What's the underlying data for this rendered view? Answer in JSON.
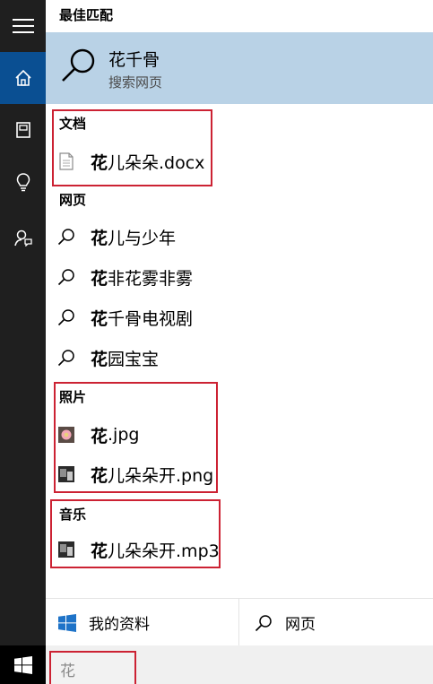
{
  "sidebar": {
    "items": [
      {
        "name": "menu",
        "active": false
      },
      {
        "name": "home",
        "active": true
      },
      {
        "name": "notebook",
        "active": false
      },
      {
        "name": "reminders",
        "active": false
      },
      {
        "name": "feedback",
        "active": false
      }
    ]
  },
  "results": {
    "best_match_label": "最佳匹配",
    "best_match": {
      "title": "花千骨",
      "subtitle": "搜索网页"
    },
    "documents_label": "文档",
    "documents": [
      {
        "bold": "花",
        "rest": "儿朵朵.docx",
        "icon": "document-icon"
      }
    ],
    "web_label": "网页",
    "web": [
      {
        "bold": "花",
        "rest": "儿与少年"
      },
      {
        "bold": "花",
        "rest": "非花雾非雾"
      },
      {
        "bold": "花",
        "rest": "千骨电视剧"
      },
      {
        "bold": "花",
        "rest": "园宝宝"
      }
    ],
    "photos_label": "照片",
    "photos": [
      {
        "bold": "花",
        "rest": ".jpg"
      },
      {
        "bold": "花",
        "rest": "儿朵朵开.png"
      }
    ],
    "music_label": "音乐",
    "music": [
      {
        "bold": "花",
        "rest": "儿朵朵开.mp3"
      }
    ]
  },
  "footer": {
    "my_stuff": "我的资料",
    "web": "网页"
  },
  "search": {
    "query": "花"
  },
  "colors": {
    "highlight": "#b9d2e6",
    "accent": "#0a4f92",
    "annotation": "#cc2233"
  }
}
